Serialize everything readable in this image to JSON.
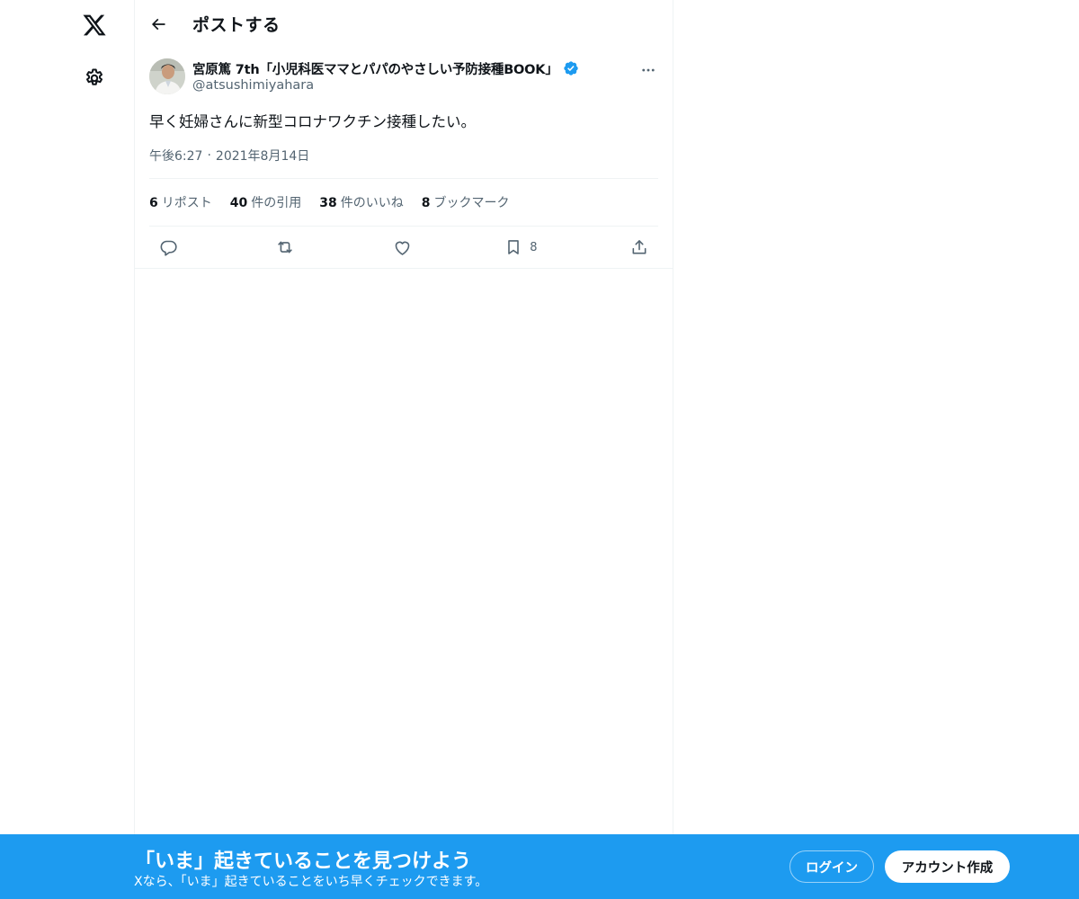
{
  "nav": {
    "logo_icon": "x-logo-icon",
    "settings_icon": "gear-icon"
  },
  "header": {
    "back_icon": "arrow-left-icon",
    "title": "ポストする"
  },
  "post": {
    "display_name": "宮原篤 7th「小児科医ママとパパのやさしい予防接種BOOK」",
    "handle": "@atsushimiyahara",
    "verified": true,
    "verified_color": "#1d9bf0",
    "text": "早く妊婦さんに新型コロナワクチン接種したい。",
    "time": "午後6:27",
    "separator": "·",
    "date": "2021年8月14日"
  },
  "stats": {
    "reposts_count": "6",
    "reposts_label": "リポスト",
    "quotes_count": "40",
    "quotes_label": "件の引用",
    "likes_count": "38",
    "likes_label": "件のいいね",
    "bookmarks_count": "8",
    "bookmarks_label": "ブックマーク"
  },
  "actions": {
    "reply_icon": "reply-icon",
    "repost_icon": "repost-icon",
    "like_icon": "heart-icon",
    "bookmark_icon": "bookmark-icon",
    "bookmark_count": "8",
    "share_icon": "share-icon"
  },
  "banner": {
    "title": "「いま」起きていることを見つけよう",
    "subtitle": "Xなら、「いま」起きていることをいち早くチェックできます。",
    "login_label": "ログイン",
    "signup_label": "アカウント作成",
    "background": "#1d9bf0"
  }
}
